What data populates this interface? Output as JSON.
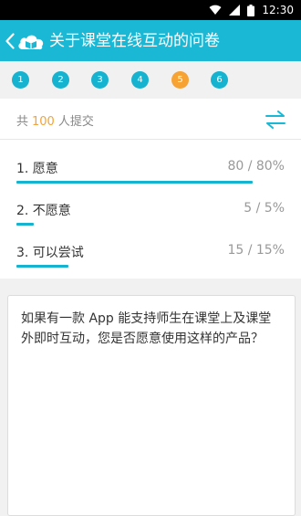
{
  "status_bar": {
    "time": "12:30",
    "icons": [
      "wifi-icon",
      "signal-icon",
      "battery-icon"
    ]
  },
  "app_bar": {
    "title": "关于课堂在线互动的问卷",
    "back_icon": "chevron-left-icon",
    "logo_icon": "cloud-book-logo"
  },
  "steps": [
    {
      "label": "1",
      "active": false
    },
    {
      "label": "2",
      "active": false
    },
    {
      "label": "3",
      "active": false
    },
    {
      "label": "4",
      "active": false
    },
    {
      "label": "5",
      "active": true
    },
    {
      "label": "6",
      "active": false
    }
  ],
  "summary": {
    "prefix": "共",
    "count": "100",
    "suffix": "人提交",
    "swap_icon": "swap-arrows-icon"
  },
  "options": [
    {
      "label": "1.  愿意",
      "stat": "80 / 80%",
      "percent": 80
    },
    {
      "label": "2.  不愿意",
      "stat": "5 / 5%",
      "percent": 5
    },
    {
      "label": "3.  可以尝试",
      "stat": "15 / 15%",
      "percent": 15
    }
  ],
  "question": {
    "text": "如果有一款 App 能支持师生在课堂上及课堂外即时互动，您是否愿意使用这样的产品？"
  },
  "colors": {
    "accent": "#1bb8d6",
    "active_step": "#f6a333",
    "count": "#f6a333"
  }
}
